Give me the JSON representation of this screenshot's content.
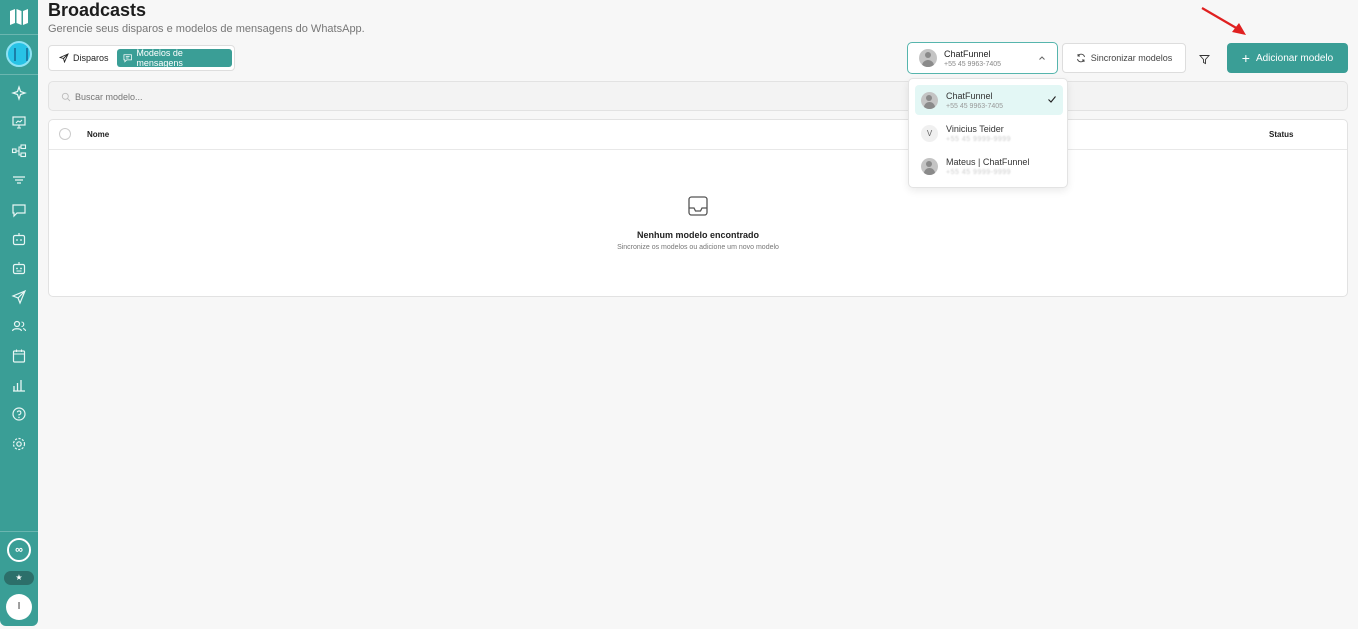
{
  "header": {
    "title": "Broadcasts",
    "subtitle": "Gerencie seus disparos e modelos de mensagens do WhatsApp."
  },
  "tabs": [
    {
      "label": "Disparos",
      "active": false
    },
    {
      "label": "Modelos de mensagens",
      "active": true
    }
  ],
  "channel_select": {
    "selected_name": "ChatFunnel",
    "selected_phone": "+55 45 9963-7405"
  },
  "toolbar": {
    "sync_label": "Sincronizar modelos",
    "add_label": "Adicionar modelo"
  },
  "search": {
    "placeholder": "Buscar modelo..."
  },
  "table": {
    "columns": [
      "Nome",
      "Status"
    ],
    "empty_title": "Nenhum modelo encontrado",
    "empty_desc": "Sincronize os modelos ou adicione um novo modelo"
  },
  "dropdown": {
    "items": [
      {
        "name": "ChatFunnel",
        "phone": "+55 45 9963-7405",
        "selected": true,
        "avatar": "image"
      },
      {
        "name": "Vinicius Teider",
        "phone": "+55 45 9999-9999",
        "selected": false,
        "avatar": "V"
      },
      {
        "name": "Mateus | ChatFunnel",
        "phone": "+55 45 9999-9999",
        "selected": false,
        "avatar": "image"
      }
    ]
  },
  "sidebar": {
    "bottom": {
      "infinity": "∞",
      "star": "★",
      "user_initial": "I"
    }
  },
  "colors": {
    "accent": "#3a9e96",
    "arrow": "#e02020"
  }
}
